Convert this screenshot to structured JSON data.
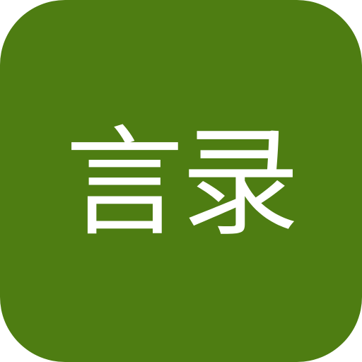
{
  "app_icon": {
    "label": "言录",
    "background_color": "#4e7d12",
    "text_color": "#ffffff"
  }
}
